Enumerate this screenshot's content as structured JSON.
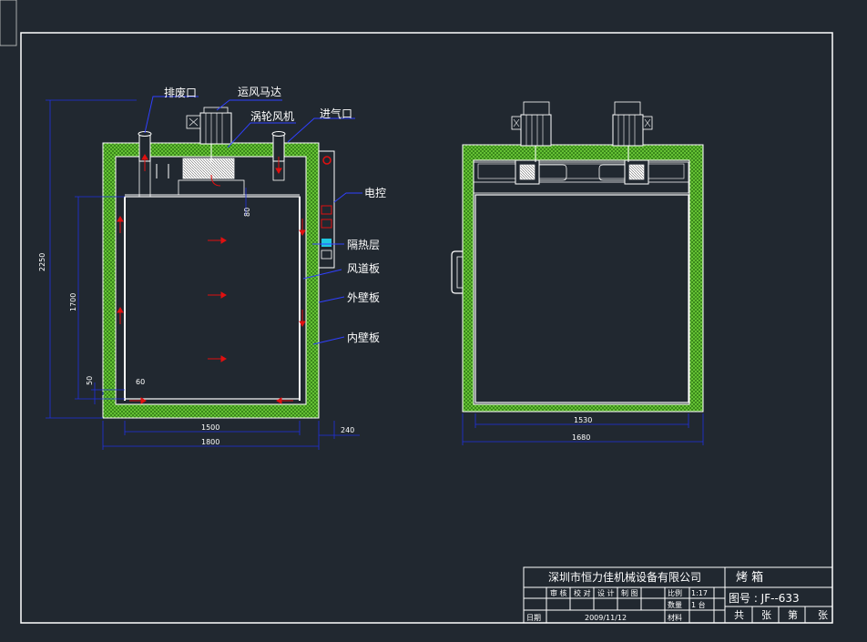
{
  "labels": {
    "exhaust_port": "排废口",
    "fan_motor": "运风马达",
    "turbo_fan": "涡轮风机",
    "air_inlet": "进气口",
    "electric_control": "电控",
    "insulation_layer": "隔热层",
    "duct_plate": "风道板",
    "outer_wall": "外壁板",
    "inner_wall": "内壁板"
  },
  "dimensions": {
    "total_height": "2250",
    "inner_height": "1700",
    "duct_gap": "80",
    "bottom_50": "50",
    "bottom_60": "60",
    "inner_width": "1500",
    "total_width": "1800",
    "panel_width": "240",
    "side_inner_width": "1530",
    "side_total_width": "1680"
  },
  "title_block": {
    "company": "深圳市恒力佳机械设备有限公司",
    "product": "烤 箱",
    "row_audit": "审 核",
    "row_check": "校 对",
    "row_design": "设 计",
    "row_draw": "制 图",
    "scale_label": "比例",
    "scale_value": "1:17",
    "qty_label": "数量",
    "qty_value": "1 台",
    "material_label": "材料",
    "date_label": "日期",
    "date_value": "2009/11/12",
    "drawing_no": "图号 : JF--633",
    "total": "共",
    "sheet1": "张",
    "page": "第",
    "sheet2": "张"
  },
  "colors": {
    "background": "#212830",
    "frame": "#ffffff",
    "insulation": "#3d8a1a",
    "dimension": "#2030e0",
    "arrow": "#e01010",
    "leader": "#3040ff",
    "cyan_panel": "#20c8e0"
  }
}
